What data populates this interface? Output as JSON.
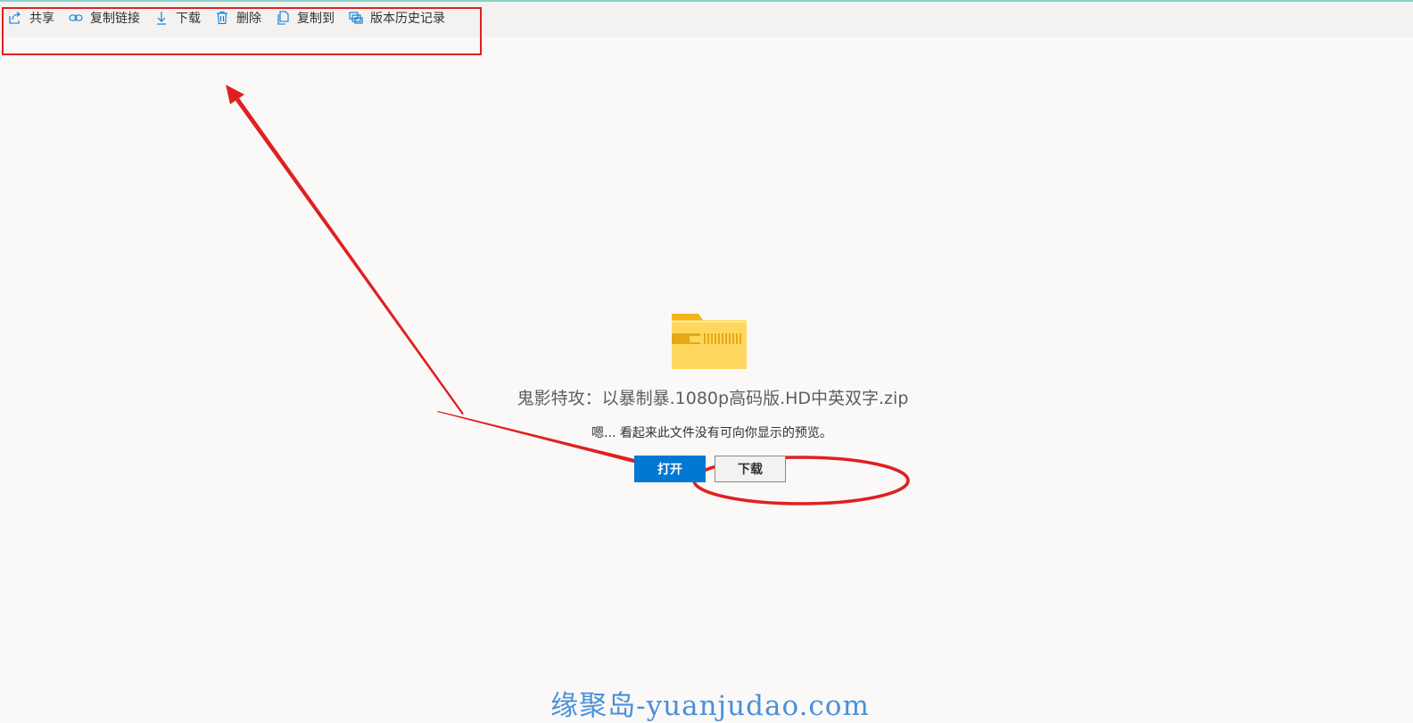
{
  "toolbar": {
    "items": [
      {
        "label": "共享",
        "icon": "share-icon"
      },
      {
        "label": "复制链接",
        "icon": "link-icon"
      },
      {
        "label": "下载",
        "icon": "download-icon"
      },
      {
        "label": "删除",
        "icon": "delete-icon"
      },
      {
        "label": "复制到",
        "icon": "copy-to-icon"
      },
      {
        "label": "版本历史记录",
        "icon": "version-history-icon"
      }
    ]
  },
  "preview": {
    "file_icon": "zip-folder-icon",
    "file_name": "鬼影特攻：以暴制暴.1080p高码版.HD中英双字.zip",
    "message": "嗯... 看起来此文件没有可向你显示的预览。",
    "open_label": "打开",
    "download_label": "下载"
  },
  "watermark": "缘聚岛-yuanjudao.com",
  "colors": {
    "accent": "#0078d4",
    "annotation_red": "#e02020",
    "toolbar_bg": "#f3f2f1",
    "page_bg": "#faf9f8",
    "watermark": "#4a90d9"
  }
}
